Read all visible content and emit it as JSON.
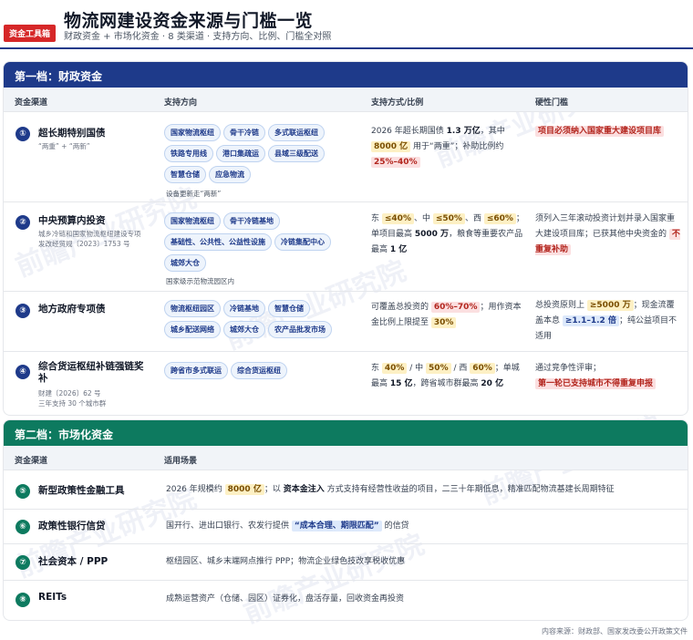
{
  "header": {
    "tag": "资金工具箱",
    "title": "物流网建设资金来源与门槛一览",
    "subtitle": "财政资金 + 市场化资金 · 8 类渠道 · 支持方向、比例、门槛全对照"
  },
  "section1": {
    "title": "第一档：财政资金",
    "columns": [
      "资金渠道",
      "支持方向",
      "支持方式/比例",
      "硬性门槛"
    ],
    "rows": [
      {
        "num": "①",
        "name": "超长期特别国债",
        "sub": "“两重” + “两新”",
        "chips": [
          "国家物流枢纽",
          "骨干冷链",
          "多式联运枢纽",
          "铁路专用线",
          "港口集疏运",
          "县域三级配送",
          "智慧仓储",
          "应急物流"
        ],
        "note": "设备更新走“两新”",
        "mode": {
          "p1": "2026 年超长期国债 ",
          "p2": "1.3 万亿",
          "p3": "，其中 ",
          "p4": "8000 亿",
          "p5": " 用于“两重”；补助比例约 ",
          "p6": "25%–40%"
        },
        "threshold": {
          "p1": "项目必须纳入国家重大建设项目库"
        }
      },
      {
        "num": "②",
        "name": "中央预算内投资",
        "sub1": "城乡冷链和国家物流枢纽建设专项",
        "sub2": "发改经贸规〔2023〕1753 号",
        "chips": [
          "国家物流枢纽",
          "骨干冷链基地",
          "基础性、公共性、公益性设施",
          "冷链集配中心",
          "城郊大仓"
        ],
        "note": "国家级示范物流园区内",
        "mode": {
          "p1": "东 ",
          "p2": "≤40%",
          "p3": "、中 ",
          "p4": "≤50%",
          "p5": "、西 ",
          "p6": "≤60%",
          "p7": "；单项目最高 ",
          "p8": "5000 万",
          "p9": "，粮食等重要农产品最高 ",
          "p10": "1 亿"
        },
        "threshold": {
          "p1": "须列入三年滚动投资计划并录入国家重大建设项目库；已获其他中央资金的 ",
          "p2": "不重复补助"
        }
      },
      {
        "num": "③",
        "name": "地方政府专项债",
        "chips": [
          "物流枢纽园区",
          "冷链基地",
          "智慧仓储",
          "城乡配送网络",
          "城郊大仓",
          "农产品批发市场"
        ],
        "mode": {
          "p1": "可覆盖总投资的 ",
          "p2": "60%–70%",
          "p3": "；用作资本金比例上限提至 ",
          "p4": "30%"
        },
        "threshold": {
          "p1": "总投资原则上 ",
          "p2": "≥5000 万",
          "p3": "；现金流覆盖本息 ",
          "p4": "≥1.1–1.2 倍",
          "p5": "；纯公益项目不适用"
        }
      },
      {
        "num": "④",
        "name": "综合货运枢纽补链强链奖补",
        "sub1": "财建〔2026〕62 号",
        "sub2": "三年支持 30 个城市群",
        "chips": [
          "跨省市多式联运",
          "综合货运枢纽"
        ],
        "mode": {
          "p1": "东 ",
          "p2": "40%",
          "p3": " / 中 ",
          "p4": "50%",
          "p5": " / 西 ",
          "p6": "60%",
          "p7": "；单城最高 ",
          "p8": "15 亿",
          "p9": "，跨省城市群最高 ",
          "p10": "20 亿"
        },
        "threshold": {
          "p1": "通过竞争性评审；",
          "p2": "第一轮已支持城市不得重复申报"
        }
      }
    ]
  },
  "section2": {
    "title": "第二档：市场化资金",
    "columns": [
      "资金渠道",
      "适用场景"
    ],
    "rows": [
      {
        "num": "⑤",
        "name": "新型政策性金融工具",
        "scene": {
          "p1": "2026 年规模约 ",
          "p2": "8000 亿",
          "p3": "；以 ",
          "p4": "资本金注入",
          "p5": " 方式支持有经营性收益的项目，二三十年期低息，精准匹配物流基建长周期特征"
        }
      },
      {
        "num": "⑥",
        "name": "政策性银行信贷",
        "scene": {
          "p1": "国开行、进出口银行、农发行提供 ",
          "p2": "“成本合理、期限匹配”",
          "p3": " 的信贷"
        }
      },
      {
        "num": "⑦",
        "name": "社会资本 / PPP",
        "scene": {
          "p1": "枢纽园区、城乡末端网点推行 PPP；物流企业绿色技改享税收优惠"
        }
      },
      {
        "num": "⑧",
        "name": "REITs",
        "scene": {
          "p1": "成熟运营资产（仓储、园区）证券化，盘活存量，回收资金再投资"
        }
      }
    ]
  },
  "footer": "内容来源：财政部、国家发改委公开政策文件",
  "watermark": "前瞻产业研究院"
}
